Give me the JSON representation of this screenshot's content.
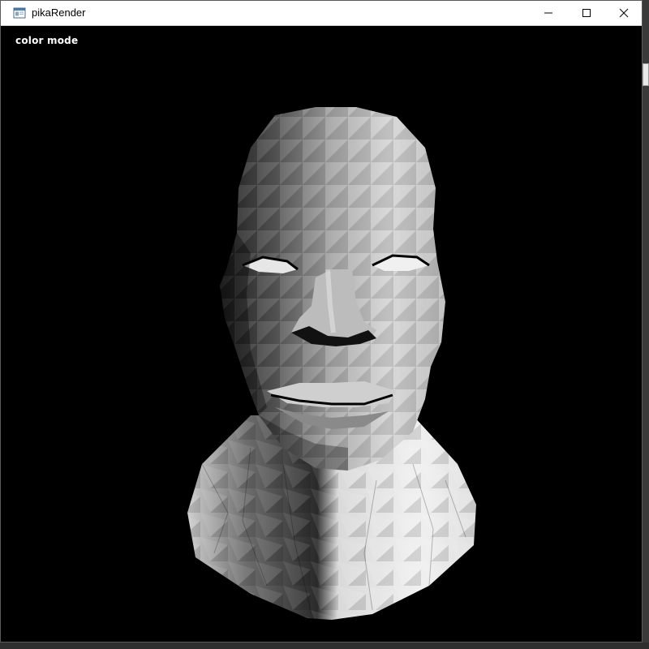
{
  "window": {
    "title": "pikaRender",
    "app_icon": "window-app-icon",
    "controls": [
      "minimize-icon",
      "maximize-icon",
      "close-icon"
    ]
  },
  "viewport": {
    "mode_label": "color mode",
    "background": "#000000",
    "render_subject": "flat-shaded grayscale 3D head mesh"
  },
  "colors": {
    "titlebar": "#ffffff",
    "title_text": "#000000",
    "viewport_bg": "#000000",
    "label_text": "#ffffff"
  }
}
